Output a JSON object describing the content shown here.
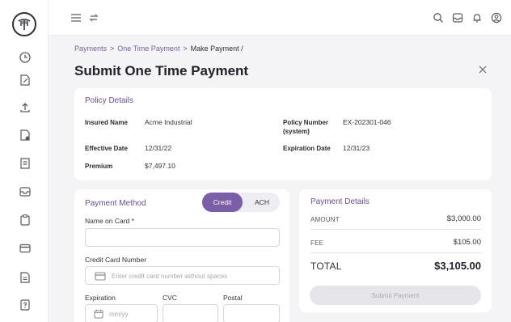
{
  "nav": {
    "breadcrumb": [
      "Payments",
      "One Time Payment",
      "Make Payment /"
    ],
    "separator": ">"
  },
  "page": {
    "title": "Submit One Time Payment"
  },
  "policy": {
    "section_title": "Policy Details",
    "insured_name_label": "Insured Name",
    "insured_name": "Acme Industrial",
    "policy_number_label_1": "Policy Number",
    "policy_number_label_2": "(system)",
    "policy_number": "EX-202301-046",
    "effective_date_label": "Effective Date",
    "effective_date": "12/31/22",
    "expiration_date_label": "Expiration Date",
    "expiration_date": "12/31/23",
    "premium_label": "Premium",
    "premium": "$7,497.10"
  },
  "payment_method": {
    "section_title": "Payment Method",
    "toggle": {
      "credit": "Credit",
      "ach": "ACH",
      "selected": "Credit"
    },
    "name_on_card_label": "Name on Card *",
    "name_on_card_value": "",
    "card_number_label": "Credit Card Number",
    "card_number_placeholder": "Enter credit card number without spaces",
    "expiration_label": "Expiration",
    "expiration_placeholder": "mm/yy",
    "cvc_label": "CVC",
    "postal_label": "Postal"
  },
  "payment_details": {
    "section_title": "Payment Details",
    "amount_label": "AMOUNT",
    "amount": "$3,000.00",
    "fee_label": "FEE",
    "fee": "$105.00",
    "total_label": "TOTAL",
    "total": "$3,105.00",
    "submit_label": "Submit Payment"
  },
  "colors": {
    "accent": "#7b5ea7",
    "title_purple": "#6a4d9c",
    "background": "#f4f4f6",
    "disabled_button": "#e6e6ea"
  },
  "icons": {
    "sidebar": [
      "clock-icon",
      "document-edit-icon",
      "upload-icon",
      "document-check-icon",
      "document-list-icon",
      "inbox-icon",
      "clipboard-icon",
      "credit-card-icon",
      "document-icon",
      "help-document-icon"
    ],
    "topbar": [
      "menu-icon",
      "swap-arrows-icon",
      "search-icon",
      "inbox-icon",
      "bell-icon",
      "user-icon"
    ]
  }
}
